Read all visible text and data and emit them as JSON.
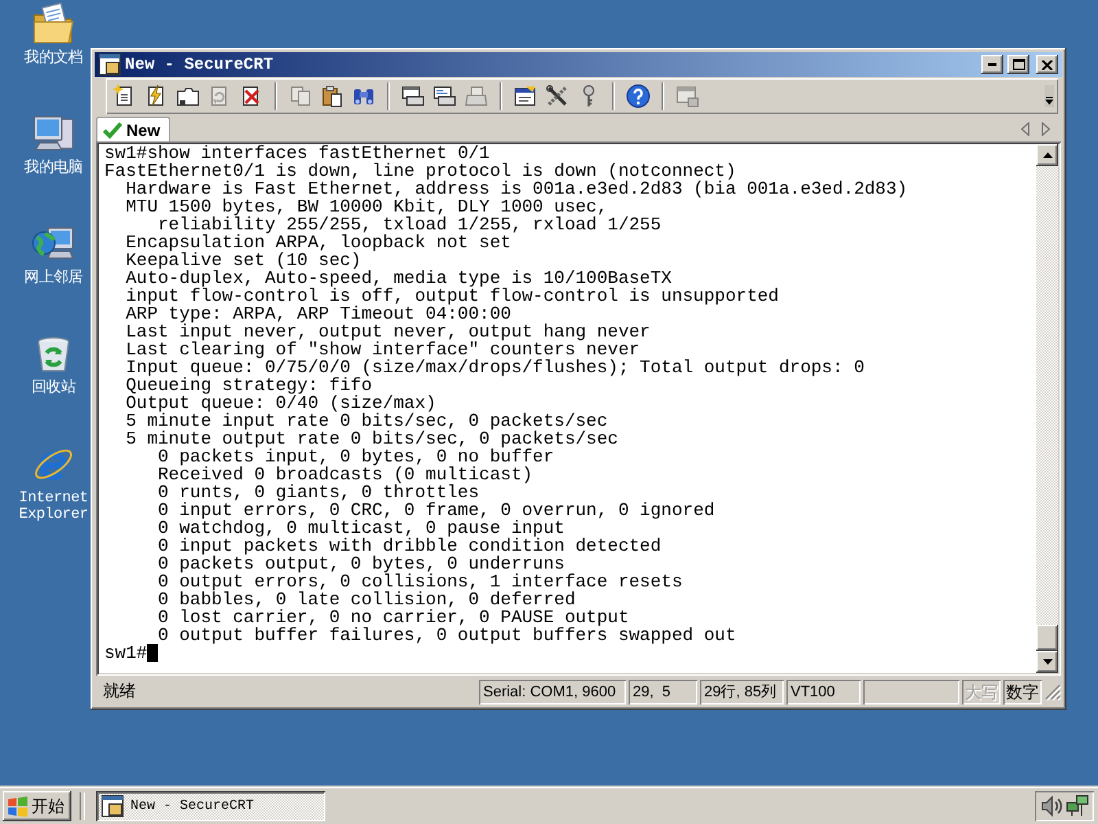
{
  "desktop": {
    "icons": [
      {
        "label": "我的文档"
      },
      {
        "label": "我的电脑"
      },
      {
        "label": "网上邻居"
      },
      {
        "label": "回收站"
      },
      {
        "label": "Internet Explorer"
      }
    ]
  },
  "window": {
    "title": "New - SecureCRT"
  },
  "toolbar": {
    "groups": [
      [
        {
          "disabled": false
        },
        {
          "disabled": false
        },
        {
          "disabled": false
        },
        {
          "disabled": true
        },
        {
          "disabled": false
        }
      ],
      [
        {
          "disabled": true
        },
        {
          "disabled": false
        },
        {
          "disabled": false
        }
      ],
      [
        {
          "disabled": false
        },
        {
          "disabled": false
        },
        {
          "disabled": true
        }
      ],
      [
        {
          "disabled": false
        },
        {
          "disabled": false
        },
        {
          "disabled": false
        }
      ],
      [
        {
          "disabled": false
        }
      ],
      [
        {
          "disabled": true
        }
      ]
    ]
  },
  "tabs": [
    {
      "label": "New",
      "selected": true,
      "connected": true
    }
  ],
  "terminal": {
    "lines": [
      "sw1#show interfaces fastEthernet 0/1",
      "FastEthernet0/1 is down, line protocol is down (notconnect)",
      "  Hardware is Fast Ethernet, address is 001a.e3ed.2d83 (bia 001a.e3ed.2d83)",
      "  MTU 1500 bytes, BW 10000 Kbit, DLY 1000 usec,",
      "     reliability 255/255, txload 1/255, rxload 1/255",
      "  Encapsulation ARPA, loopback not set",
      "  Keepalive set (10 sec)",
      "  Auto-duplex, Auto-speed, media type is 10/100BaseTX",
      "  input flow-control is off, output flow-control is unsupported",
      "  ARP type: ARPA, ARP Timeout 04:00:00",
      "  Last input never, output never, output hang never",
      "  Last clearing of \"show interface\" counters never",
      "  Input queue: 0/75/0/0 (size/max/drops/flushes); Total output drops: 0",
      "  Queueing strategy: fifo",
      "  Output queue: 0/40 (size/max)",
      "  5 minute input rate 0 bits/sec, 0 packets/sec",
      "  5 minute output rate 0 bits/sec, 0 packets/sec",
      "     0 packets input, 0 bytes, 0 no buffer",
      "     Received 0 broadcasts (0 multicast)",
      "     0 runts, 0 giants, 0 throttles",
      "     0 input errors, 0 CRC, 0 frame, 0 overrun, 0 ignored",
      "     0 watchdog, 0 multicast, 0 pause input",
      "     0 input packets with dribble condition detected",
      "     0 packets output, 0 bytes, 0 underruns",
      "     0 output errors, 0 collisions, 1 interface resets",
      "     0 babbles, 0 late collision, 0 deferred",
      "     0 lost carrier, 0 no carrier, 0 PAUSE output",
      "     0 output buffer failures, 0 output buffers swapped out",
      "sw1#"
    ],
    "cursor_visible": true
  },
  "status_bar": {
    "message": "就绪",
    "panels": [
      {
        "text": "Serial: COM1, 9600"
      },
      {
        "text": "29,  5"
      },
      {
        "text": "29行, 85列"
      },
      {
        "text": "VT100"
      }
    ],
    "indicators": [
      {
        "label": "大写",
        "on": false
      },
      {
        "label": "数字",
        "on": true
      }
    ]
  },
  "taskbar": {
    "start_label": "开始",
    "tasks": [
      {
        "label": "New - SecureCRT",
        "selected": true
      }
    ]
  }
}
